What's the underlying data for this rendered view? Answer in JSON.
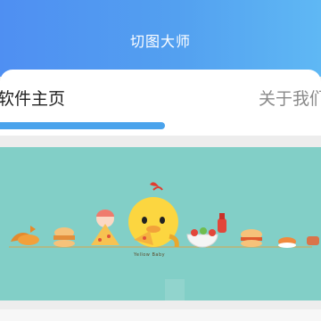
{
  "header": {
    "title": "切图大师"
  },
  "tabs": [
    {
      "label": "软件主页",
      "selected": true
    },
    {
      "label": "关于我们",
      "selected": false
    }
  ],
  "banner": {
    "illustration": "cartoon-food-characters-illustration",
    "caption": "Yellow Baby",
    "background_color": "#82cfc7"
  },
  "colors": {
    "accent": "#4aa3ec",
    "header_start": "#4f8ff2",
    "header_end": "#5fb8f4"
  }
}
